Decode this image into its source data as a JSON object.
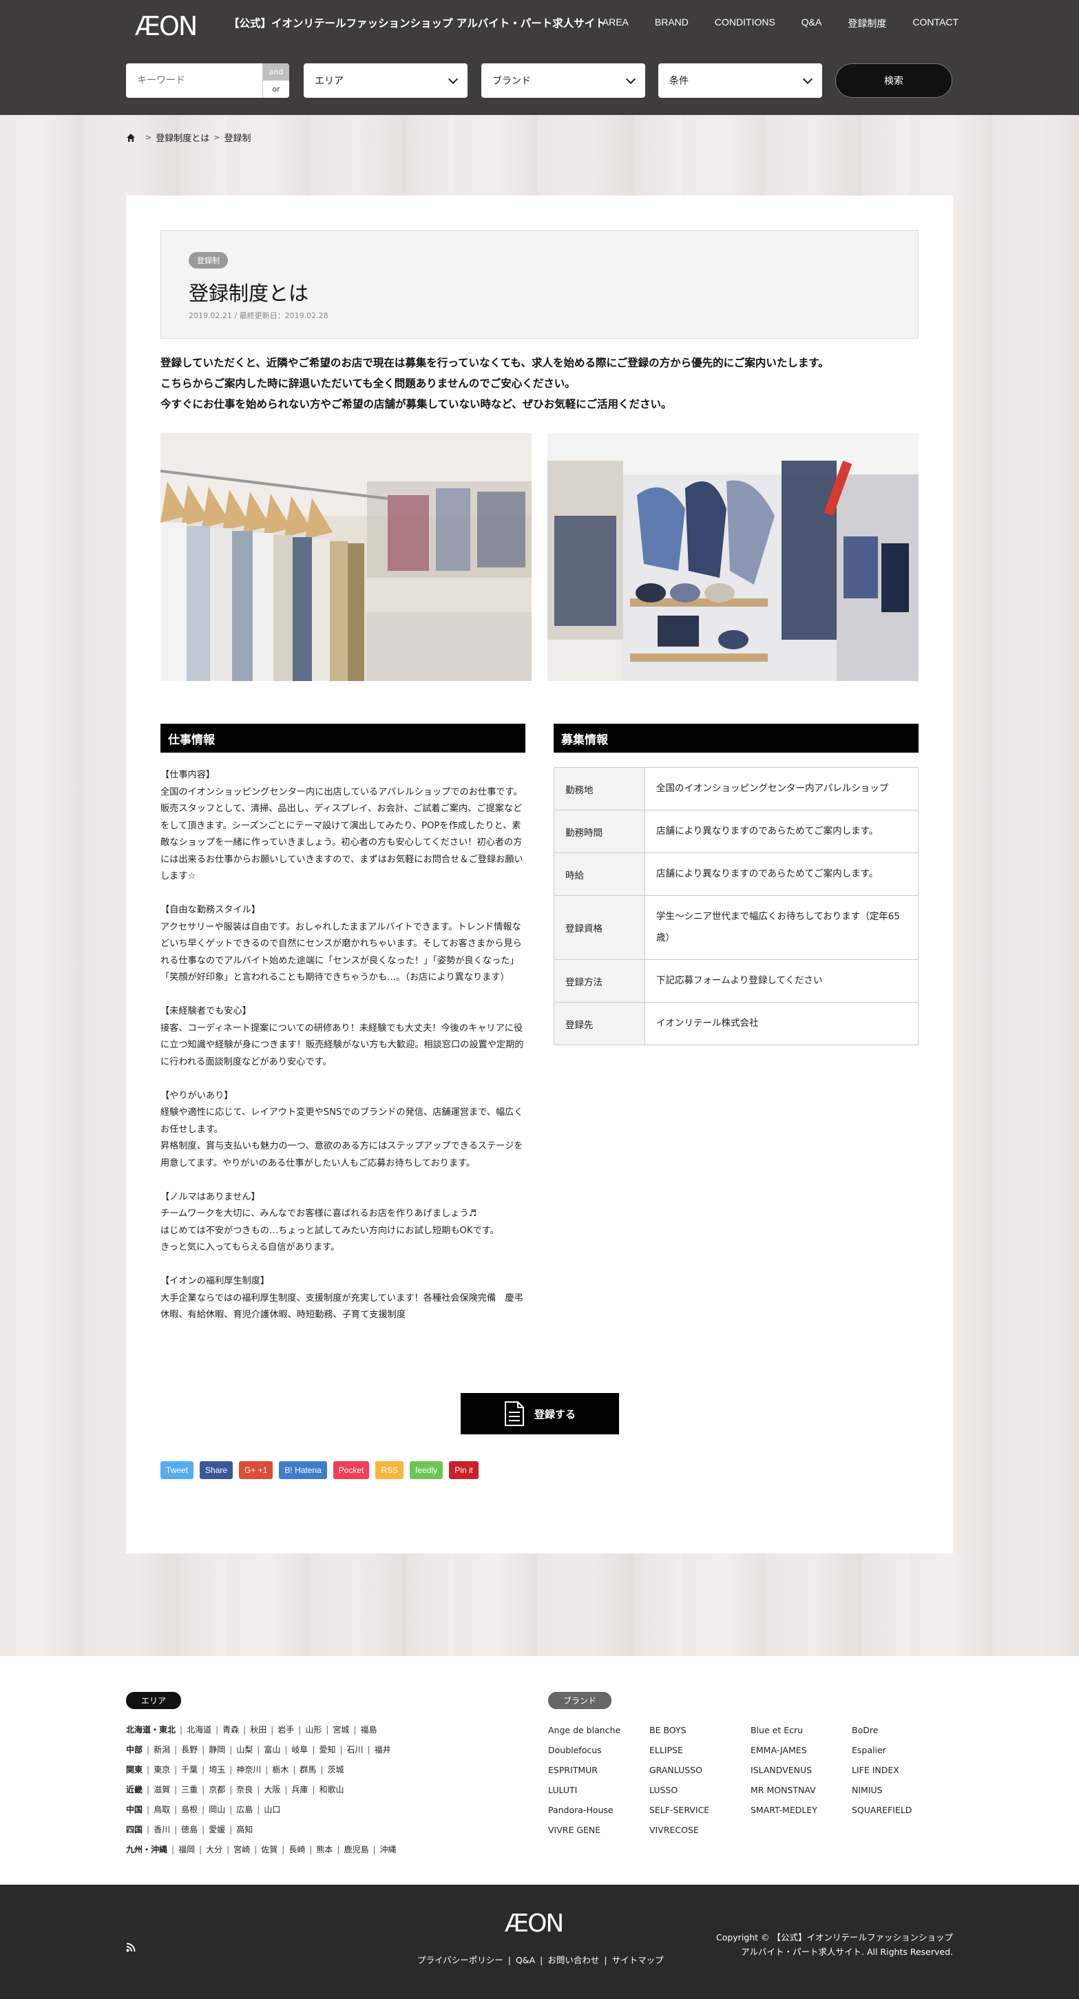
{
  "header": {
    "logo": "ÆON",
    "site_title": "【公式】イオンリテールファッションショップ アルバイト・パート求人サイト",
    "nav": [
      "AREA",
      "BRAND",
      "CONDITIONS",
      "Q&A",
      "登録制度",
      "CONTACT"
    ],
    "search": {
      "keyword_placeholder": "キーワード",
      "and_label": "and",
      "or_label": "or",
      "area_label": "エリア",
      "brand_label": "ブランド",
      "condition_label": "条件",
      "button_label": "検索"
    }
  },
  "breadcrumb": {
    "parent": "登録制度とは",
    "current": "登録制"
  },
  "article": {
    "category": "登録制",
    "title": "登録制度とは",
    "date": "2019.02.21 / 最終更新日：2019.02.28",
    "lead": [
      "登録していただくと、近隣やご希望のお店で現在は募集を行っていなくても、求人を始める際にご登録の方から優先的にご案内いたします。",
      "こちらからご案内した時に辞退いただいても全く問題ありませんのでご安心ください。",
      "今すぐにお仕事を始められない方やご希望の店舗が募集していない時など、ぜひお気軽にご活用ください。"
    ],
    "work_heading": "仕事情報",
    "work_blocks": [
      "【仕事内容】\n全国のイオンショッピングセンター内に出店しているアパレルショップでのお仕事です。販売スタッフとして、清掃、品出し、ディスプレイ、お会計、ご試着ご案内、ご提案などをして頂きます。シーズンごとにテーマ設けて演出してみたり、POPを作成したりと、素敵なショップを一緒に作っていきましょう。初心者の方も安心してください！初心者の方には出来るお仕事からお願いしていきますので、まずはお気軽にお問合せ＆ご登録お願いします☆",
      "【自由な勤務スタイル】\nアクセサリーや服装は自由です。おしゃれしたままアルバイトできます。トレンド情報などいち早くゲットできるので自然にセンスが磨かれちゃいます。そしてお客さまから見られる仕事なのでアルバイト始めた途端に「センスが良くなった！」「姿勢が良くなった」「笑顔が好印象」と言われることも期待できちゃうかも…。（お店により異なります）",
      "【未経験者でも安心】\n接客、コーディネート提案についての研修あり！未経験でも大丈夫！今後のキャリアに役に立つ知識や経験が身につきます！販売経験がない方も大歓迎。相談窓口の設置や定期的に行われる面談制度などがあり安心です。",
      "【やりがいあり】\n経験や適性に応じて、レイアウト変更やSNSでのブランドの発信、店舗運営まで、幅広くお任せします。\n昇格制度、賞与支払いも魅力の一つ、意欲のある方にはステップアップできるステージを用意してます。やりがいのある仕事がしたい人もご応募お待ちしております。",
      "【ノルマはありません】\nチームワークを大切に、みんなでお客様に喜ばれるお店を作りあげましょう♬\nはじめては不安がつきもの…ちょっと試してみたい方向けにお試し短期もOKです。\nきっと気に入ってもらえる自信があります。",
      "【イオンの福利厚生制度】\n大手企業ならではの福利厚生制度、支援制度が充実しています！各種社会保険完備　慶弔休暇、有給休暇、育児介護休暇、時短勤務、子育て支援制度"
    ],
    "recruit_heading": "募集情報",
    "recruit_rows": [
      {
        "key": "勤務地",
        "value": "全国のイオンショッピングセンター内アパレルショップ"
      },
      {
        "key": "勤務時間",
        "value": "店舗により異なりますのであらためてご案内します。"
      },
      {
        "key": "時給",
        "value": "店舗により異なりますのであらためてご案内します。"
      },
      {
        "key": "登録資格",
        "value": "学生〜シニア世代まで幅広くお待ちしております（定年65歳）"
      },
      {
        "key": "登録方法",
        "value": "下記応募フォームより登録してください"
      },
      {
        "key": "登録先",
        "value": "イオンリテール株式会社"
      }
    ],
    "register_button": "登録する"
  },
  "share": [
    {
      "label": "Tweet",
      "color": "#55acee"
    },
    {
      "label": "Share",
      "color": "#3b5998"
    },
    {
      "label": "G+ +1",
      "color": "#dd4b39"
    },
    {
      "label": "B! Hatena",
      "color": "#3d7dca"
    },
    {
      "label": "Pocket",
      "color": "#ee4056"
    },
    {
      "label": "RSS",
      "color": "#f7b53c"
    },
    {
      "label": "feedly",
      "color": "#6cc655"
    },
    {
      "label": "Pin it",
      "color": "#cb2027"
    }
  ],
  "footer": {
    "area_label": "エリア",
    "brand_label": "ブランド",
    "areas": [
      {
        "region": "北海道・東北",
        "prefs": [
          "北海道",
          "青森",
          "秋田",
          "岩手",
          "山形",
          "宮城",
          "福島"
        ]
      },
      {
        "region": "中部",
        "prefs": [
          "新潟",
          "長野",
          "静岡",
          "山梨",
          "富山",
          "岐阜",
          "愛知",
          "石川",
          "福井"
        ]
      },
      {
        "region": "関東",
        "prefs": [
          "東京",
          "千葉",
          "埼玉",
          "神奈川",
          "栃木",
          "群馬",
          "茨城"
        ]
      },
      {
        "region": "近畿",
        "prefs": [
          "滋賀",
          "三重",
          "京都",
          "奈良",
          "大阪",
          "兵庫",
          "和歌山"
        ]
      },
      {
        "region": "中国",
        "prefs": [
          "鳥取",
          "島根",
          "岡山",
          "広島",
          "山口"
        ]
      },
      {
        "region": "四国",
        "prefs": [
          "香川",
          "徳島",
          "愛媛",
          "高知"
        ]
      },
      {
        "region": "九州・沖縄",
        "prefs": [
          "福岡",
          "大分",
          "宮崎",
          "佐賀",
          "長崎",
          "熊本",
          "鹿児島",
          "沖縄"
        ]
      }
    ],
    "brands": [
      "Ange de blanche",
      "BE BOYS",
      "Blue et Ecru",
      "BoDre",
      "Doublefocus",
      "ELLIPSE",
      "EMMA-JAMES",
      "Espalier",
      "ESPRITMUR",
      "GRANLUSSO",
      "ISLANDVENUS",
      "LIFE INDEX",
      "LULUTI",
      "LUSSO",
      "MR MONSTNAV",
      "NIMIUS",
      "Pandora-House",
      "SELF-SERVICE",
      "SMART-MEDLEY",
      "SQUAREFIELD",
      "VIVRE GENE",
      "VIVRECOSE"
    ],
    "bottom_logo": "ÆON",
    "links": [
      "プライバシーポリシー",
      "Q&A",
      "お問い合わせ",
      "サイトマップ"
    ],
    "copyright": "Copyright ©  【公式】イオンリテールファッションショップ アルバイト・パート求人サイト. All Rights Reserved."
  }
}
